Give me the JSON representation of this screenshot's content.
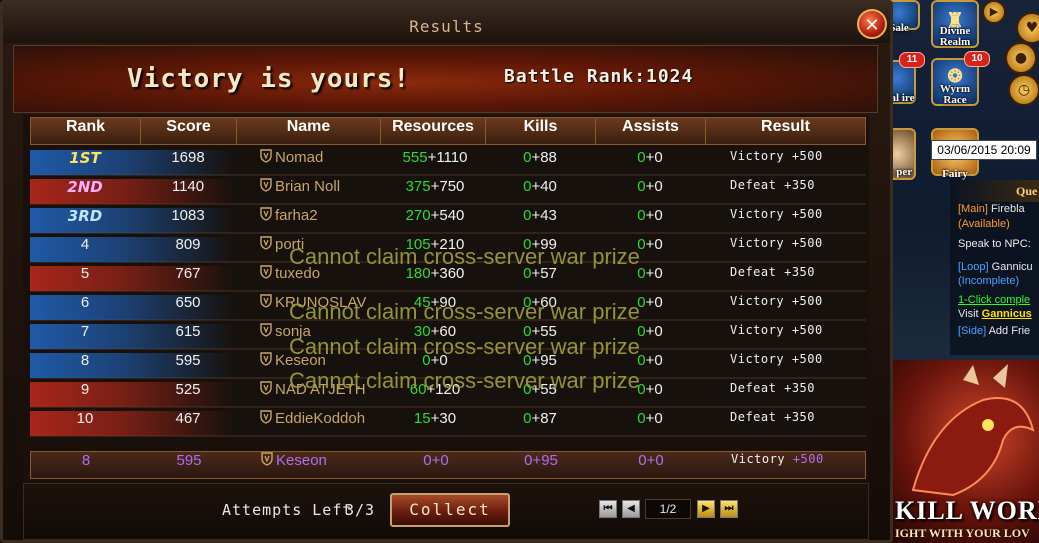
{
  "window": {
    "title": "Results",
    "close_icon": "close-icon"
  },
  "header": {
    "victory_text": "Victory is yours!",
    "battle_rank_label": "Battle Rank:",
    "battle_rank_value": "1024"
  },
  "table": {
    "columns": [
      "Rank",
      "Score",
      "Name",
      "Resources",
      "Kills",
      "Assists",
      "Result"
    ],
    "rows": [
      {
        "rank": "1ST",
        "score": "1698",
        "name": "Nomad",
        "res_a": "555",
        "res_b": "+1110",
        "kills_a": "0",
        "kills_b": "+88",
        "ast_a": "0",
        "ast_b": "+0",
        "result": "Victory",
        "reward": "+500",
        "team": "blue"
      },
      {
        "rank": "2ND",
        "score": "1140",
        "name": "Brian Noll",
        "res_a": "375",
        "res_b": "+750",
        "kills_a": "0",
        "kills_b": "+40",
        "ast_a": "0",
        "ast_b": "+0",
        "result": "Defeat",
        "reward": "+350",
        "team": "red"
      },
      {
        "rank": "3RD",
        "score": "1083",
        "name": "farha2",
        "res_a": "270",
        "res_b": "+540",
        "kills_a": "0",
        "kills_b": "+43",
        "ast_a": "0",
        "ast_b": "+0",
        "result": "Victory",
        "reward": "+500",
        "team": "blue"
      },
      {
        "rank": "4",
        "score": "809",
        "name": "porti",
        "res_a": "105",
        "res_b": "+210",
        "kills_a": "0",
        "kills_b": "+99",
        "ast_a": "0",
        "ast_b": "+0",
        "result": "Victory",
        "reward": "+500",
        "team": "blue"
      },
      {
        "rank": "5",
        "score": "767",
        "name": "tuxedo",
        "res_a": "180",
        "res_b": "+360",
        "kills_a": "0",
        "kills_b": "+57",
        "ast_a": "0",
        "ast_b": "+0",
        "result": "Defeat",
        "reward": "+350",
        "team": "red"
      },
      {
        "rank": "6",
        "score": "650",
        "name": "KRUNOSLAV",
        "res_a": "45",
        "res_b": "+90",
        "kills_a": "0",
        "kills_b": "+60",
        "ast_a": "0",
        "ast_b": "+0",
        "result": "Victory",
        "reward": "+500",
        "team": "blue"
      },
      {
        "rank": "7",
        "score": "615",
        "name": "sonja",
        "res_a": "30",
        "res_b": "+60",
        "kills_a": "0",
        "kills_b": "+55",
        "ast_a": "0",
        "ast_b": "+0",
        "result": "Victory",
        "reward": "+500",
        "team": "blue"
      },
      {
        "rank": "8",
        "score": "595",
        "name": "Keseon",
        "res_a": "0",
        "res_b": "+0",
        "kills_a": "0",
        "kills_b": "+95",
        "ast_a": "0",
        "ast_b": "+0",
        "result": "Victory",
        "reward": "+500",
        "team": "blue"
      },
      {
        "rank": "9",
        "score": "525",
        "name": "NAD ATJETH",
        "res_a": "60",
        "res_b": "+120",
        "kills_a": "0",
        "kills_b": "+55",
        "ast_a": "0",
        "ast_b": "+0",
        "result": "Defeat",
        "reward": "+350",
        "team": "red"
      },
      {
        "rank": "10",
        "score": "467",
        "name": "EddieKoddoh",
        "res_a": "15",
        "res_b": "+30",
        "kills_a": "0",
        "kills_b": "+87",
        "ast_a": "0",
        "ast_b": "+0",
        "result": "Defeat",
        "reward": "+350",
        "team": "red"
      }
    ],
    "my_row": {
      "rank": "8",
      "score": "595",
      "name": "Keseon",
      "res": "0+0",
      "kills": "0+95",
      "ast": "0+0",
      "result": "Victory",
      "reward": "+500"
    }
  },
  "warnings": [
    "Cannot claim cross-server war prize",
    "Cannot claim cross-server war prize",
    "Cannot claim cross-server war prize",
    "Cannot claim cross-server war prize"
  ],
  "footer": {
    "attempts_label": "Attempts Left",
    "attempts_value": "3/3",
    "collect_label": "Collect",
    "page_value": "1/2"
  },
  "side": {
    "sale_label": "Sale",
    "divine_realm_label": "Divine Realm",
    "eternal_label": "rnal ire",
    "wyrm_race_label": "Wyrm Race",
    "badge_1": "11",
    "badge_2": "10",
    "battle_keeper_label": "tle per",
    "fairy_label": "Fairy",
    "datetime": "03/06/2015 20:09",
    "quest_header": "Que",
    "q1_tag": "[Main]",
    "q1_title": "Firebla",
    "q1_status": "(Available)",
    "q1_action": "Speak to NPC:",
    "q2_tag": "[Loop]",
    "q2_title": "Gannicu",
    "q2_status": "(Incomplete)",
    "q2_link": "1-Click comple",
    "q2_visit": "Visit",
    "q2_npc": "Gannicus",
    "q3_tag": "[Side]",
    "q3_title": "Add Frie",
    "banner_line1": "KILL WORL",
    "banner_line2": "IGHT WITH YOUR LOV"
  },
  "colors": {
    "team_blue": "#1f5aa8",
    "team_red": "#a8261a",
    "gain_green": "#2fdc2f",
    "self_purple": "#b26cf0",
    "warning_olive": "#9a9a3a"
  }
}
